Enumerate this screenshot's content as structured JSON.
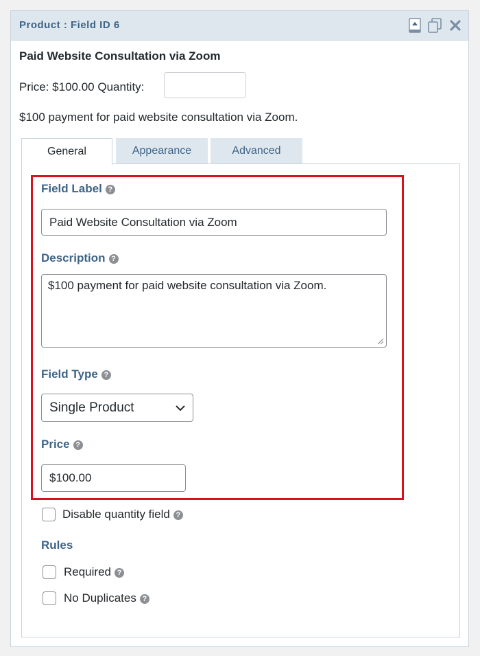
{
  "header": {
    "title": "Product : Field ID 6",
    "icons": [
      "collapse-icon",
      "duplicate-icon",
      "delete-icon"
    ]
  },
  "preview": {
    "title": "Paid Website Consultation via Zoom",
    "price_text": "Price: $100.00 Quantity:",
    "quantity_value": "",
    "description": "$100 payment for paid website consultation via Zoom."
  },
  "tabs": [
    {
      "label": "General",
      "active": true
    },
    {
      "label": "Appearance",
      "active": false
    },
    {
      "label": "Advanced",
      "active": false
    }
  ],
  "general": {
    "field_label": {
      "label": "Field Label",
      "value": "Paid Website Consultation via Zoom"
    },
    "description": {
      "label": "Description",
      "value": "$100 payment for paid website consultation via Zoom."
    },
    "field_type": {
      "label": "Field Type",
      "selected": "Single Product"
    },
    "price": {
      "label": "Price",
      "value": "$100.00"
    },
    "disable_quantity": {
      "label": "Disable quantity field",
      "checked": false
    },
    "rules": {
      "heading": "Rules",
      "required": {
        "label": "Required",
        "checked": false
      },
      "no_duplicates": {
        "label": "No Duplicates",
        "checked": false
      }
    }
  },
  "colors": {
    "label_blue": "#3e6486",
    "header_bg": "#dfe7ee",
    "highlight_red": "#d9101d"
  }
}
